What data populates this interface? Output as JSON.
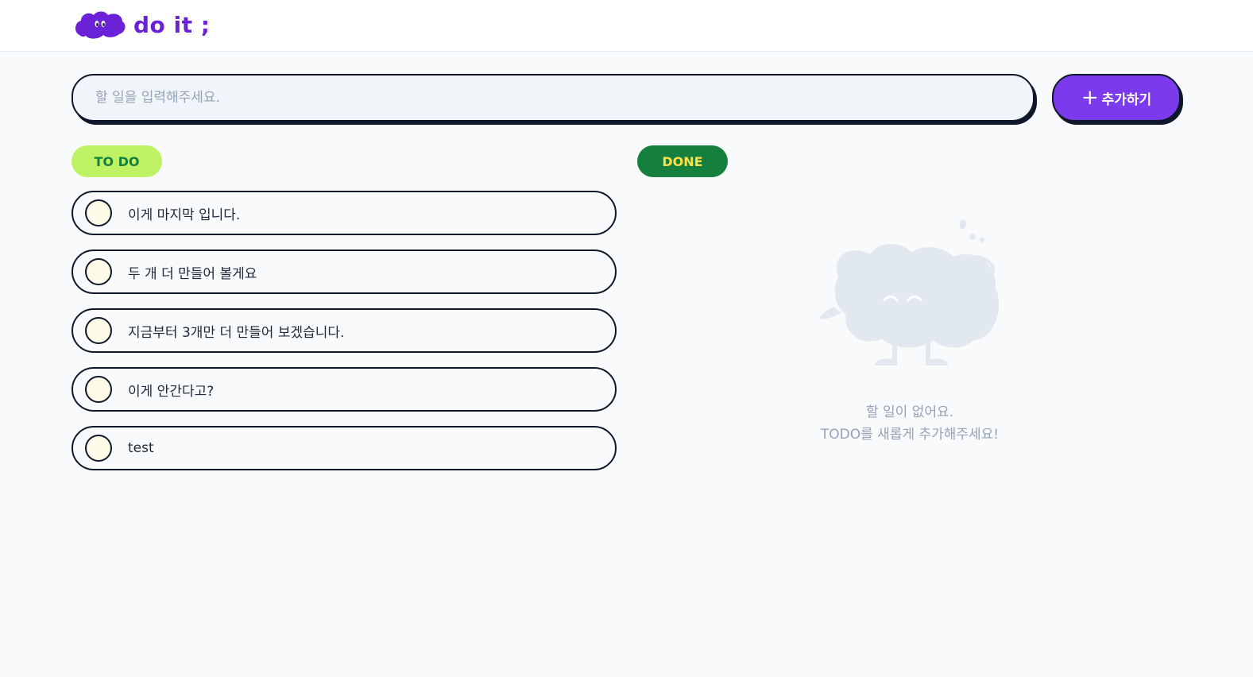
{
  "header": {
    "logo_text": "do it ;"
  },
  "input": {
    "placeholder": "할 일을 입력해주세요.",
    "value": ""
  },
  "add_button": {
    "plus": "+",
    "label": "추가하기"
  },
  "todo_section": {
    "badge": "TO DO",
    "items": [
      {
        "text": "이게 마지막 입니다."
      },
      {
        "text": "두 개 더 만들어 볼게요"
      },
      {
        "text": "지금부터 3개만 더 만들어 보겠습니다."
      },
      {
        "text": "이게 안간다고?"
      },
      {
        "text": "test"
      }
    ]
  },
  "done_section": {
    "badge": "DONE",
    "empty_line1": "할 일이 없어요.",
    "empty_line2": "TODO를 새롭게 추가해주세요!"
  },
  "colors": {
    "brand": "#7c3aed",
    "todo_badge_bg": "#bef264",
    "done_badge_bg": "#15803d",
    "done_badge_text": "#fde047",
    "checkbox_fill": "#fefce8"
  }
}
